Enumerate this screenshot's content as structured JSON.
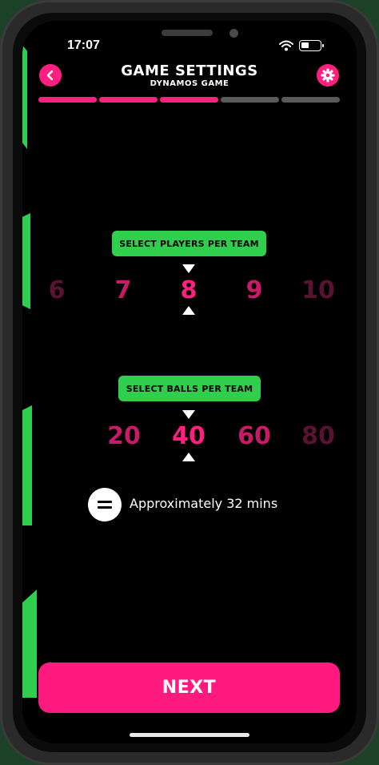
{
  "status_bar": {
    "time": "17:07"
  },
  "header": {
    "title": "GAME SETTINGS",
    "subtitle": "DYNAMOS GAME"
  },
  "progress": {
    "total_steps": 5,
    "completed_steps": 3
  },
  "players_picker": {
    "label": "SELECT PLAYERS PER TEAM",
    "options": [
      "6",
      "7",
      "8",
      "9",
      "10"
    ],
    "selected": "8"
  },
  "balls_picker": {
    "label": "SELECT BALLS PER TEAM",
    "options": [
      "20",
      "40",
      "60",
      "80"
    ],
    "selected": "40"
  },
  "estimate": {
    "symbol": "=",
    "text": "Approximately 32 mins"
  },
  "footer": {
    "next_label": "NEXT"
  },
  "colors": {
    "accent_pink": "#ff1f7f",
    "accent_green": "#2fcf4d",
    "background": "#000000"
  },
  "icons": {
    "back": "chevron-left-icon",
    "settings": "gear-icon",
    "wifi": "wifi-icon",
    "battery": "battery-icon"
  }
}
